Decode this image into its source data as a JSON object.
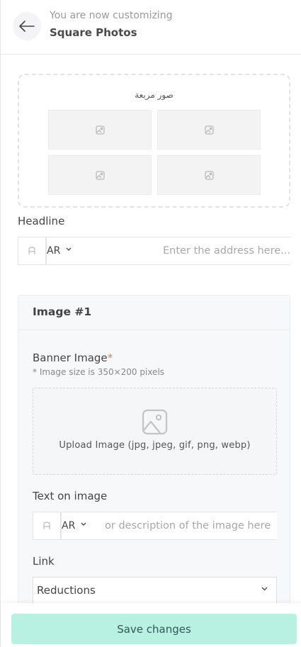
{
  "header": {
    "subtitle": "You are now customizing",
    "title": "Square Photos",
    "back_icon": "arrow-left-icon"
  },
  "preview": {
    "title": "صور مربعة",
    "tile_icon": "image-placeholder-icon"
  },
  "headline": {
    "label": "Headline",
    "lang": "AR",
    "placeholder": "...Enter the address here"
  },
  "image_card": {
    "title": "Image #1",
    "banner_label": "Banner Image",
    "required_mark": "*",
    "size_hint": "* Image size is 350×200 pixels",
    "upload_text": "Upload Image (jpg, jpeg, gif, png, webp)",
    "text_on_image_label": "Text on image",
    "text_lang": "AR",
    "text_placeholder": "or description of the image here",
    "link_label": "Link",
    "link_value": "Reductions"
  },
  "footer": {
    "save_label": "Save changes"
  },
  "colors": {
    "accent": "#b8f0e2",
    "required": "#e8824a"
  }
}
